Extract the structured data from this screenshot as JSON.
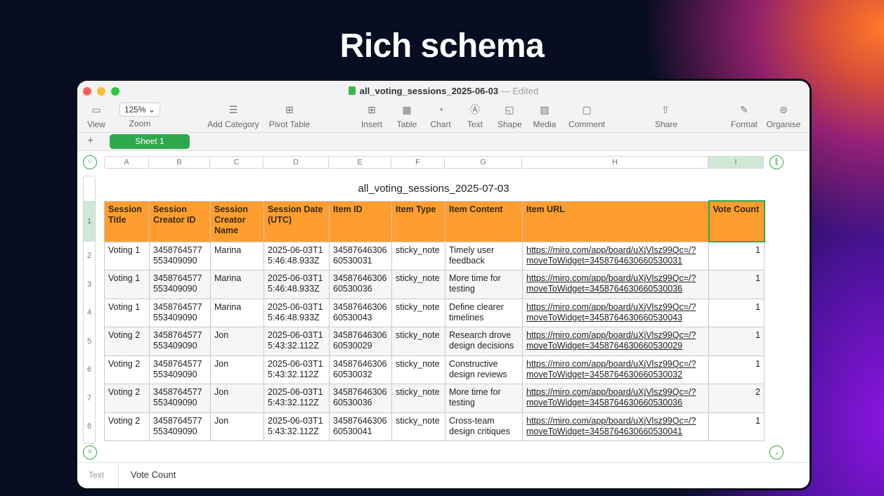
{
  "headline": "Rich schema",
  "window": {
    "doc_name": "all_voting_sessions_2025-06-03",
    "separator": " — ",
    "status": "Edited"
  },
  "toolbar": {
    "view": "View",
    "zoom_value": "125% ⌄",
    "zoom": "Zoom",
    "add_category": "Add Category",
    "pivot_table": "Pivot Table",
    "insert": "Insert",
    "table": "Table",
    "chart": "Chart",
    "text": "Text",
    "shape": "Shape",
    "media": "Media",
    "comment": "Comment",
    "share": "Share",
    "format": "Format",
    "organise": "Organise"
  },
  "sheets": {
    "add": "+",
    "active": "Sheet 1"
  },
  "columns": [
    "A",
    "B",
    "C",
    "D",
    "E",
    "F",
    "G",
    "H",
    "I"
  ],
  "rows": [
    "1",
    "2",
    "3",
    "4",
    "5",
    "6",
    "7",
    "8"
  ],
  "table": {
    "title": "all_voting_sessions_2025-07-03",
    "headers": [
      "Session Title",
      "Session Creator ID",
      "Session Creator Name",
      "Session Date (UTC)",
      "Item ID",
      "Item Type",
      "Item Content",
      "Item URL",
      "Vote Count"
    ],
    "data": [
      [
        "Voting 1",
        "3458764577 553409090",
        "Marina",
        "2025-06-03T1 5:46:48.933Z",
        "34587646306 60530031",
        "sticky_note",
        "Timely user feedback",
        "https://miro.com/app/board/uXjVlsz99Qc=/?moveToWidget=3458764630660530031",
        "1"
      ],
      [
        "Voting 1",
        "3458764577 553409090",
        "Marina",
        "2025-06-03T1 5:46:48.933Z",
        "34587646306 60530036",
        "sticky_note",
        "More time for testing",
        "https://miro.com/app/board/uXjVlsz99Qc=/?moveToWidget=3458764630660530036",
        "1"
      ],
      [
        "Voting 1",
        "3458764577 553409090",
        "Marina",
        "2025-06-03T1 5:46:48.933Z",
        "34587646306 60530043",
        "sticky_note",
        "Define clearer timelines",
        "https://miro.com/app/board/uXjVlsz99Qc=/?moveToWidget=3458764630660530043",
        "1"
      ],
      [
        "Voting 2",
        "3458764577 553409090",
        "Jon",
        "2025-06-03T1 5:43:32.112Z",
        "34587646306 60530029",
        "sticky_note",
        "Research drove design decisions",
        "https://miro.com/app/board/uXjVlsz99Qc=/?moveToWidget=3458764630660530029",
        "1"
      ],
      [
        "Voting 2",
        "3458764577 553409090",
        "Jon",
        "2025-06-03T1 5:43:32.112Z",
        "34587646306 60530032",
        "sticky_note",
        "Constructive design reviews",
        "https://miro.com/app/board/uXjVlsz99Qc=/?moveToWidget=3458764630660530032",
        "1"
      ],
      [
        "Voting 2",
        "3458764577 553409090",
        "Jon",
        "2025-06-03T1 5:43:32.112Z",
        "34587646306 60530036",
        "sticky_note",
        "More time for testing",
        "https://miro.com/app/board/uXjVlsz99Qc=/?moveToWidget=3458764630660530036",
        "2"
      ],
      [
        "Voting 2",
        "3458764577 553409090",
        "Jon",
        "2025-06-03T1 5:43:32.112Z",
        "34587646306 60530041",
        "sticky_note",
        "Cross-team design critiques",
        "https://miro.com/app/board/uXjVlsz99Qc=/?moveToWidget=3458764630660530041",
        "1"
      ]
    ]
  },
  "statusbar": {
    "label": "Text",
    "value": "Vote Count"
  },
  "colors": {
    "header_fill": "#fd9e2f",
    "accent_green": "#2ea84c"
  }
}
